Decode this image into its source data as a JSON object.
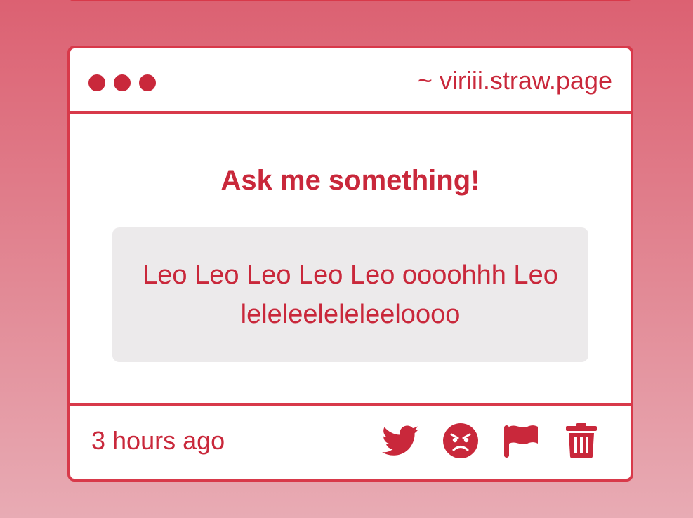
{
  "card": {
    "url": "~ viriii.straw.page",
    "prompt": "Ask me something!",
    "message": "Leo Leo Leo Leo Leo oooohhh Leo leleleeleleleeloooo",
    "timestamp": "3 hours ago",
    "actions": [
      {
        "icon": "twitter-icon"
      },
      {
        "icon": "angry-face-icon"
      },
      {
        "icon": "flag-icon"
      },
      {
        "icon": "trash-icon"
      }
    ]
  },
  "colors": {
    "accent": "#c9283b",
    "border": "#d8394a",
    "message_bg": "#eceaeb",
    "background_top": "#dc6172",
    "background_bottom": "#e8abb4"
  }
}
